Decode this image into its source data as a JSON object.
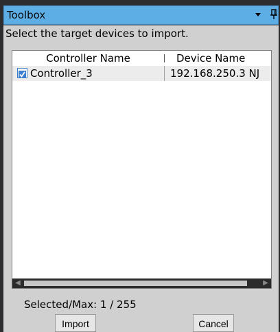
{
  "window": {
    "title": "Toolbox",
    "menu_icon": "dropdown-arrow-icon",
    "pin_icon": "pin-icon"
  },
  "instruction": "Select the target devices to import.",
  "table": {
    "columns": [
      "Controller Name",
      "Device Name"
    ],
    "rows": [
      {
        "checked": true,
        "controller_name": "Controller_3",
        "device_name": "192.168.250.3  NJ"
      }
    ]
  },
  "status": "Selected/Max: 1 / 255",
  "buttons": {
    "import_label": "Import",
    "cancel_label": "Cancel"
  },
  "colors": {
    "title_bar": "#5eaee6",
    "panel": "#d0d0d0",
    "frame": "#2d2d30"
  }
}
